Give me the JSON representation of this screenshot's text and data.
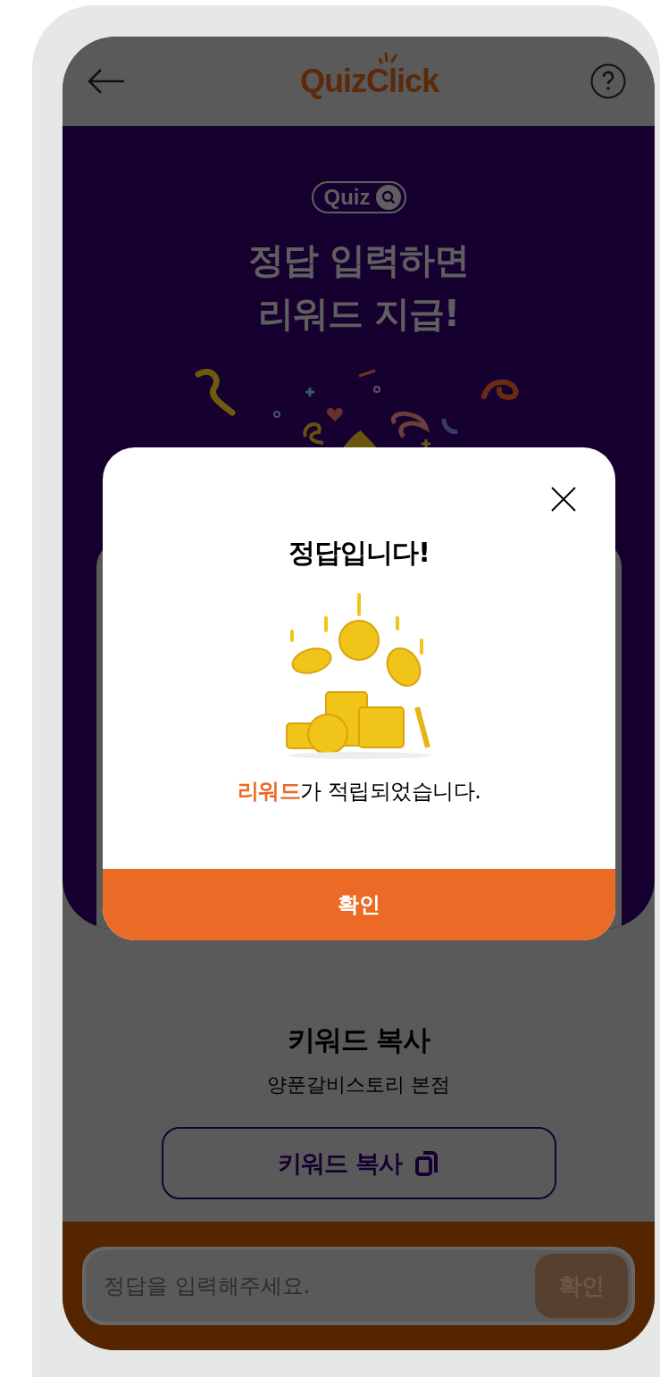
{
  "header": {
    "logo": "QuizClick"
  },
  "hero": {
    "badge": "Quiz",
    "title_lines": [
      "정답 입력하면",
      "리워드 지급!"
    ]
  },
  "keyword": {
    "title": "키워드 복사",
    "store": "양푼갈비스토리 본점",
    "copy_button": "키워드 복사"
  },
  "answer_bar": {
    "placeholder": "정답을 입력해주세요.",
    "submit": "확인",
    "submit_disabled": true
  },
  "modal": {
    "title": "정답입니다!",
    "message": "**리워드**가 적립되었습니다.",
    "confirm": "확인"
  }
}
